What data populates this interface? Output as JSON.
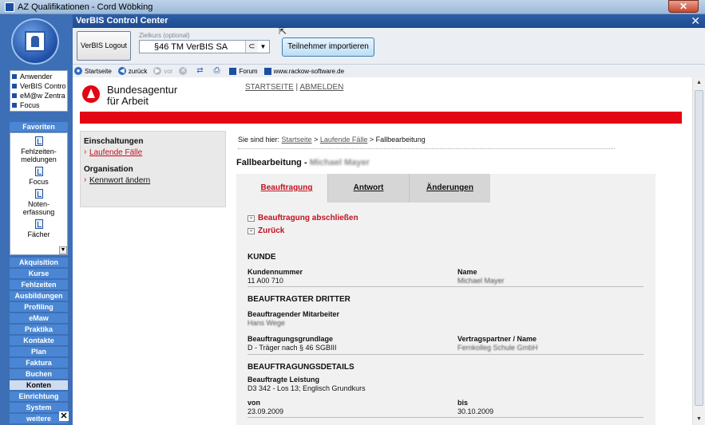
{
  "window": {
    "title": "AZ Qualifikationen - Cord Wöbking"
  },
  "control_center": {
    "title": "VerBIS Control Center",
    "close": "✕"
  },
  "sidebar": {
    "user_list": [
      "Anwender",
      "VerBIS Control",
      "eM@w Zentrale",
      "Focus"
    ],
    "favorites_header": "Favoriten",
    "favorites": [
      "Fehlzeiten-\nmeldungen",
      "Focus",
      "Noten-\nerfassung",
      "Fächer"
    ],
    "nav": [
      "Akquisition",
      "Kurse",
      "Fehlzeiten",
      "Ausbildungen",
      "Profiling",
      "eMaw",
      "Praktika",
      "Kontakte",
      "Plan",
      "Faktura",
      "Buchen",
      "Konten",
      "Einrichtung",
      "System",
      "weitere"
    ],
    "active_nav": "Konten",
    "close": "✕"
  },
  "toolbar": {
    "logout_label": "VerBIS Logout",
    "zielkurs_label": "Zielkurs (optional)",
    "zielkurs_value": "§46 TM VerBIS SA",
    "import_label": "Teilnehmer importieren"
  },
  "browser": {
    "start": "Startseite",
    "back": "zurück",
    "forward": "vor",
    "forum": "Forum",
    "site": "www.rackow-software.de"
  },
  "page": {
    "brand_line1": "Bundesagentur",
    "brand_line2": "für Arbeit",
    "top_link_start": "STARTSEITE",
    "top_link_sep": "|",
    "top_link_logout": "ABMELDEN",
    "nav_section1": "Einschaltungen",
    "nav_item1": "Laufende Fälle",
    "nav_section2": "Organisation",
    "nav_item2": "Kennwort ändern",
    "breadcrumb_prefix": "Sie sind hier:",
    "breadcrumb_1": "Startseite",
    "breadcrumb_2": "Laufende Fälle",
    "breadcrumb_current": "Fallbearbeitung",
    "title": "Fallbearbeitung - ",
    "title_name": "Michael Mayer",
    "tabs": [
      "Beauftragung",
      "Antwort",
      "Änderungen"
    ],
    "action_close": "Beauftragung abschließen",
    "action_back": "Zurück",
    "kunde_head": "KUNDE",
    "kundennummer_label": "Kundennummer",
    "kundennummer_value": "11 A00 710",
    "name_label": "Name",
    "name_value": "Michael Mayer",
    "dritter_head": "BEAUFTRAGTER DRITTER",
    "mitarbeiter_label": "Beauftragender Mitarbeiter",
    "mitarbeiter_value": "Hans Wege",
    "grundlage_label": "Beauftragungsgrundlage",
    "grundlage_value": "D - Träger nach § 46 SGBIII",
    "vertrag_label": "Vertragspartner / Name",
    "vertrag_value": "Fernkolleg Schule GmbH",
    "details_head": "BEAUFTRAGUNGSDETAILS",
    "leistung_label": "Beauftragte Leistung",
    "leistung_value": "D3 342 - Los 13; Englisch Grundkurs",
    "von_label": "von",
    "von_value": "23.09.2009",
    "bis_label": "bis",
    "bis_value": "30.10.2009"
  }
}
